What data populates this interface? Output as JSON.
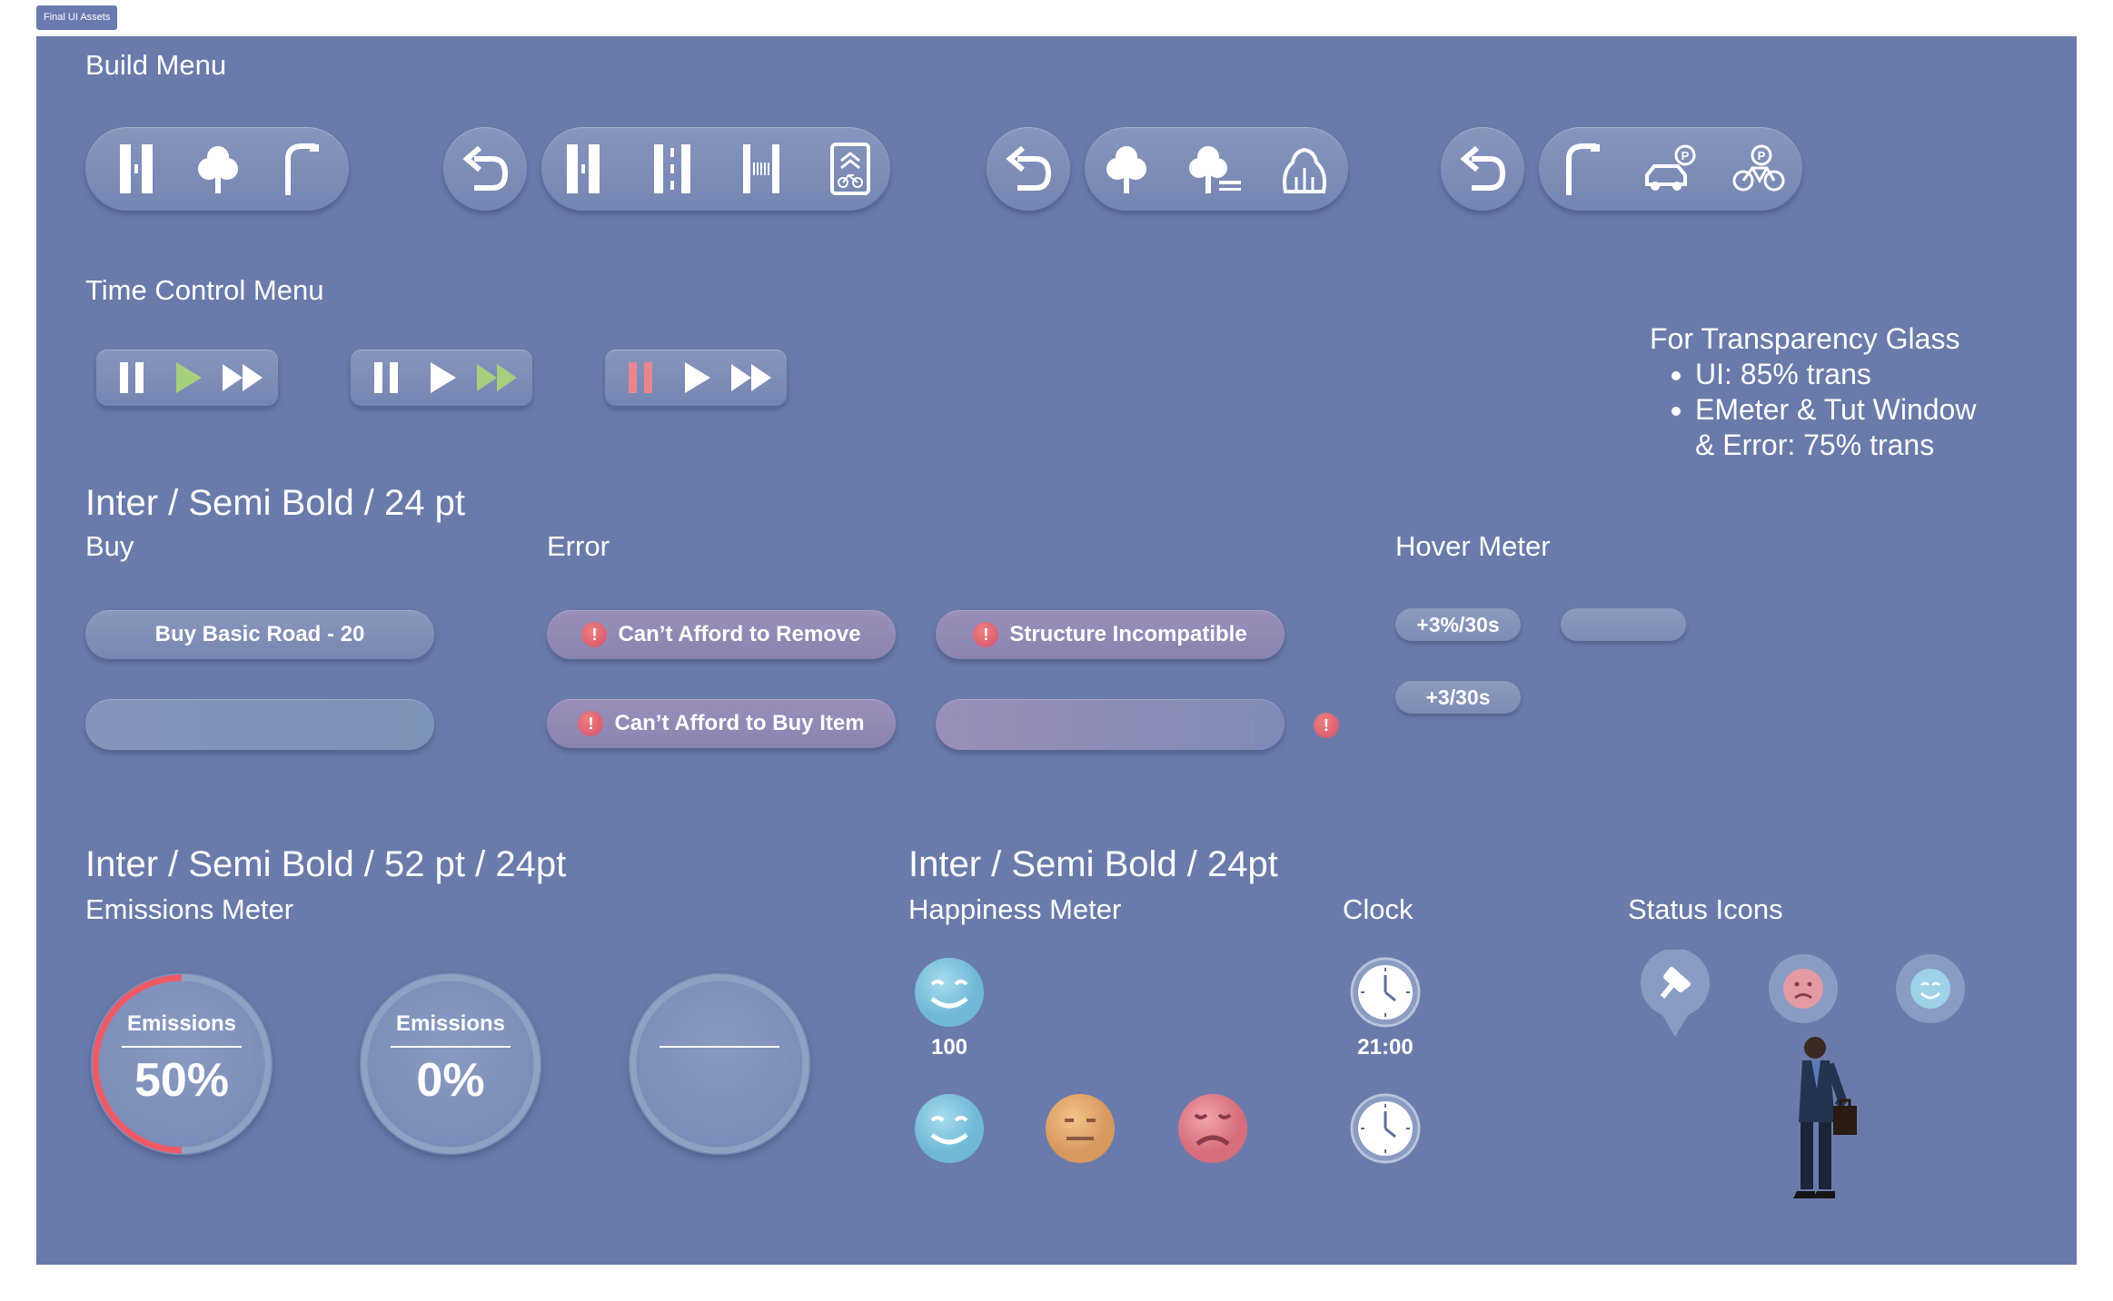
{
  "frame_tag": "Final UI Assets",
  "sections": {
    "build_menu": "Build Menu",
    "time_control_menu": "Time Control Menu",
    "font_spec_1": "Inter / Semi Bold / 24 pt",
    "font_spec_2": "Inter / Semi Bold / 52 pt / 24pt",
    "font_spec_3": "Inter / Semi Bold / 24pt"
  },
  "build_groups": {
    "main": [
      "road-icon",
      "tree-icon",
      "streetlamp-icon"
    ],
    "roads": [
      "undo-icon",
      "road-icon",
      "road-dashed-icon",
      "crosswalk-icon",
      "bike-lane-icon"
    ],
    "trees": [
      "undo-icon",
      "tree-icon",
      "tree-bench-icon",
      "bushes-icon"
    ],
    "props": [
      "undo-icon",
      "streetlamp-icon",
      "car-parking-icon",
      "bike-parking-icon"
    ]
  },
  "time_controls": [
    {
      "active": "play",
      "icons": [
        "pause-icon",
        "play-icon",
        "fast-forward-icon"
      ]
    },
    {
      "active": "fast-forward",
      "icons": [
        "pause-icon",
        "play-icon",
        "fast-forward-icon"
      ]
    },
    {
      "active": "pause",
      "icons": [
        "pause-icon",
        "play-icon",
        "fast-forward-icon"
      ]
    }
  ],
  "transparency_note": {
    "title": "For Transparency Glass",
    "items": [
      "UI: 85% trans",
      "EMeter & Tut Window",
      "& Error: 75% trans"
    ]
  },
  "buy": {
    "heading": "Buy",
    "button_label": "Buy Basic Road - 20"
  },
  "error": {
    "heading": "Error",
    "msg_remove": "Can’t Afford to Remove",
    "msg_incompatible": "Structure Incompatible",
    "msg_buy_item": "Can’t Afford to Buy Item",
    "icon_glyph": "!"
  },
  "hover_meter": {
    "heading": "Hover Meter",
    "value_percent": "+3%/30s",
    "value_flat": "+3/30s"
  },
  "emissions": {
    "heading": "Emissions Meter",
    "meters": [
      {
        "label": "Emissions",
        "value": "50%",
        "fraction": 0.5
      },
      {
        "label": "Emissions",
        "value": "0%",
        "fraction": 0
      },
      {
        "label": "",
        "value": "",
        "fraction": 0
      }
    ]
  },
  "happiness": {
    "heading": "Happiness Meter",
    "value": "100",
    "faces": [
      "happy-face-icon",
      "neutral-face-icon",
      "sad-face-icon"
    ]
  },
  "clock": {
    "heading": "Clock",
    "time": "21:00"
  },
  "status_icons": {
    "heading": "Status Icons"
  },
  "colors": {
    "canvas": "#6a7bab",
    "active_green": "#a6cf7e",
    "active_red": "#e88790",
    "emission_red": "#ec5a66"
  }
}
